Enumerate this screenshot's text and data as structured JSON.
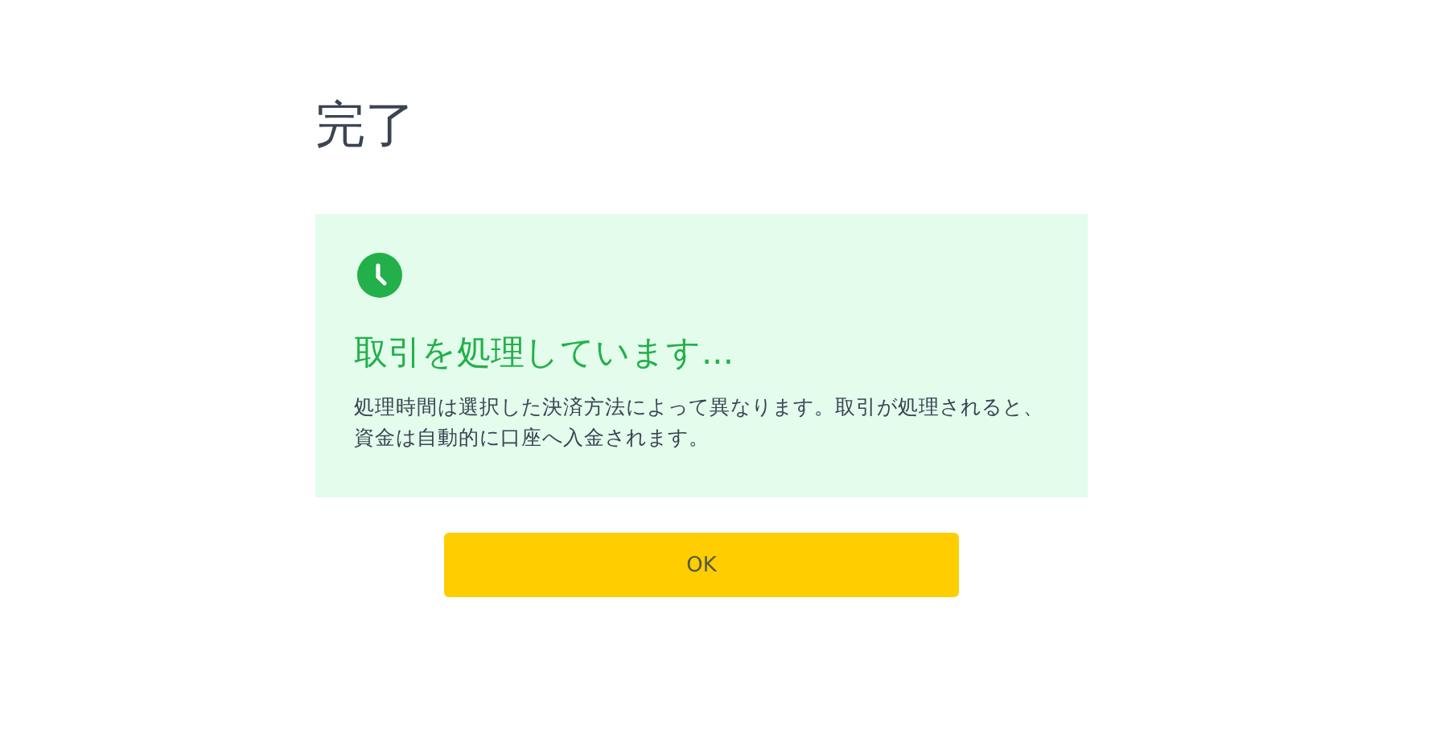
{
  "title": "完了",
  "status": {
    "kind": "processing",
    "heading": "取引を処理しています...",
    "message": "処理時間は選択した決済方法によって異なります。取引が処理されると、資金は自動的に口座へ入金されます。"
  },
  "button": {
    "label": "OK"
  }
}
